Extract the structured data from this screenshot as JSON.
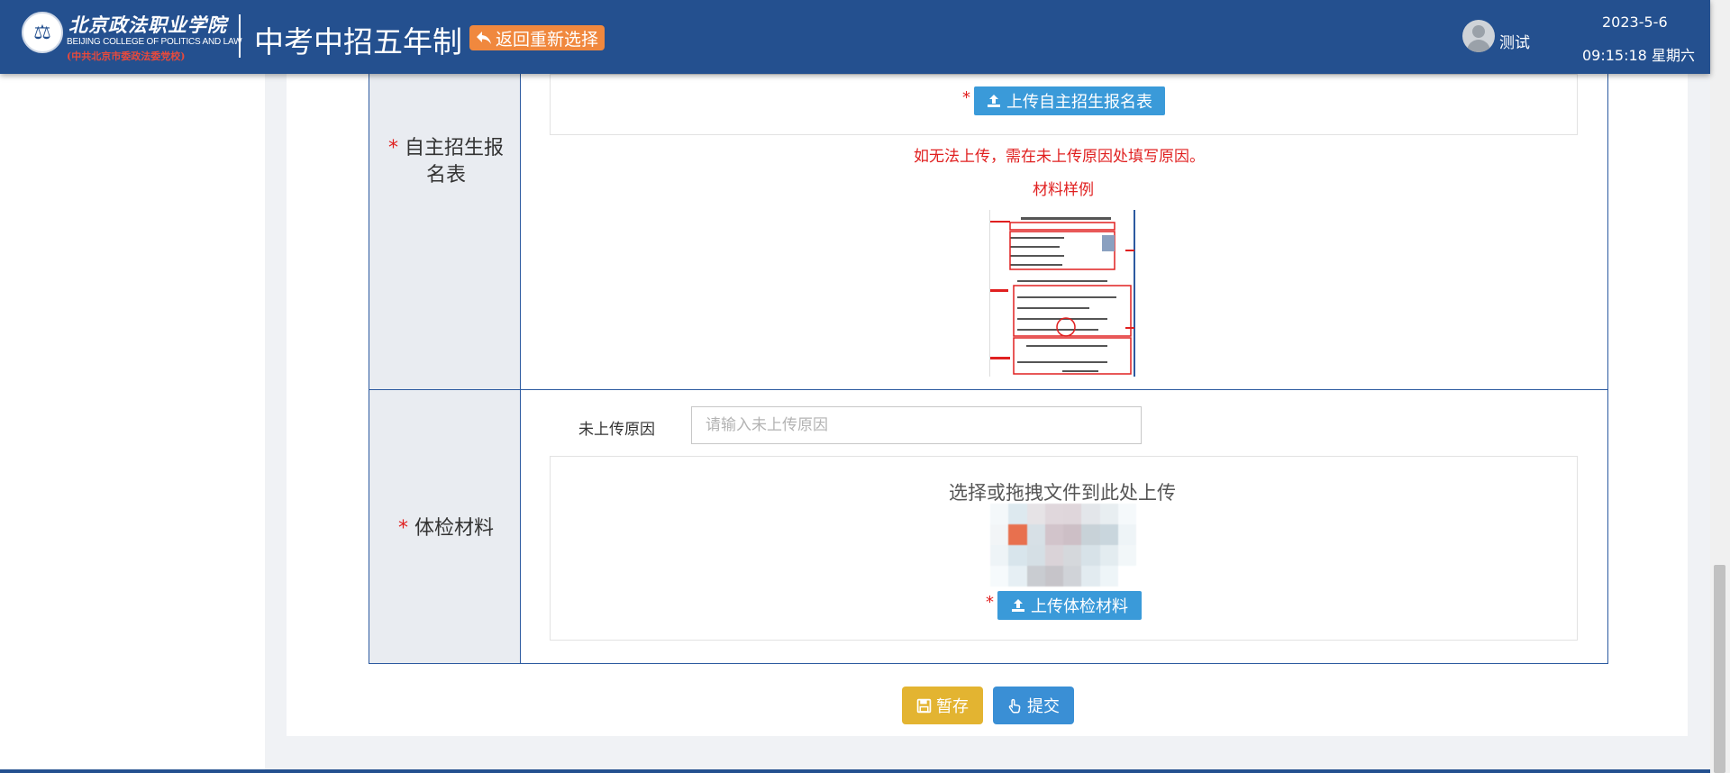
{
  "header": {
    "logo_cn": "北京政法职业学院",
    "logo_en": "BEIJING COLLEGE OF POLITICS AND LAW",
    "logo_sub": "(中共北京市委政法委党校)",
    "app_title": "中考中招五年制",
    "back_button": "返回重新选择",
    "user_name": "测试",
    "date": "2023-5-6",
    "time": "09:15:18 星期六"
  },
  "form": {
    "row1": {
      "label_line1": "自主招生报",
      "label_line2": "名表",
      "required_mark": "*",
      "upload_button": "上传自主招生报名表",
      "warning": "如无法上传，需在未上传原因处填写原因。",
      "sample_title": "材料样例"
    },
    "row2": {
      "label": "体检材料",
      "required_mark": "*",
      "reason_label": "未上传原因",
      "reason_placeholder": "请输入未上传原因",
      "reason_value": "",
      "drop_hint": "选择或拖拽文件到此处上传",
      "upload_button": "上传体检材料"
    }
  },
  "actions": {
    "save_button": "暂存",
    "submit_button": "提交"
  },
  "colors": {
    "header_bg": "#24508f",
    "back_button_bg": "#f0883e",
    "upload_button_bg": "#3a9ad9",
    "save_button_bg": "#e3b431",
    "submit_button_bg": "#3a8fd5",
    "required": "#e02020"
  }
}
